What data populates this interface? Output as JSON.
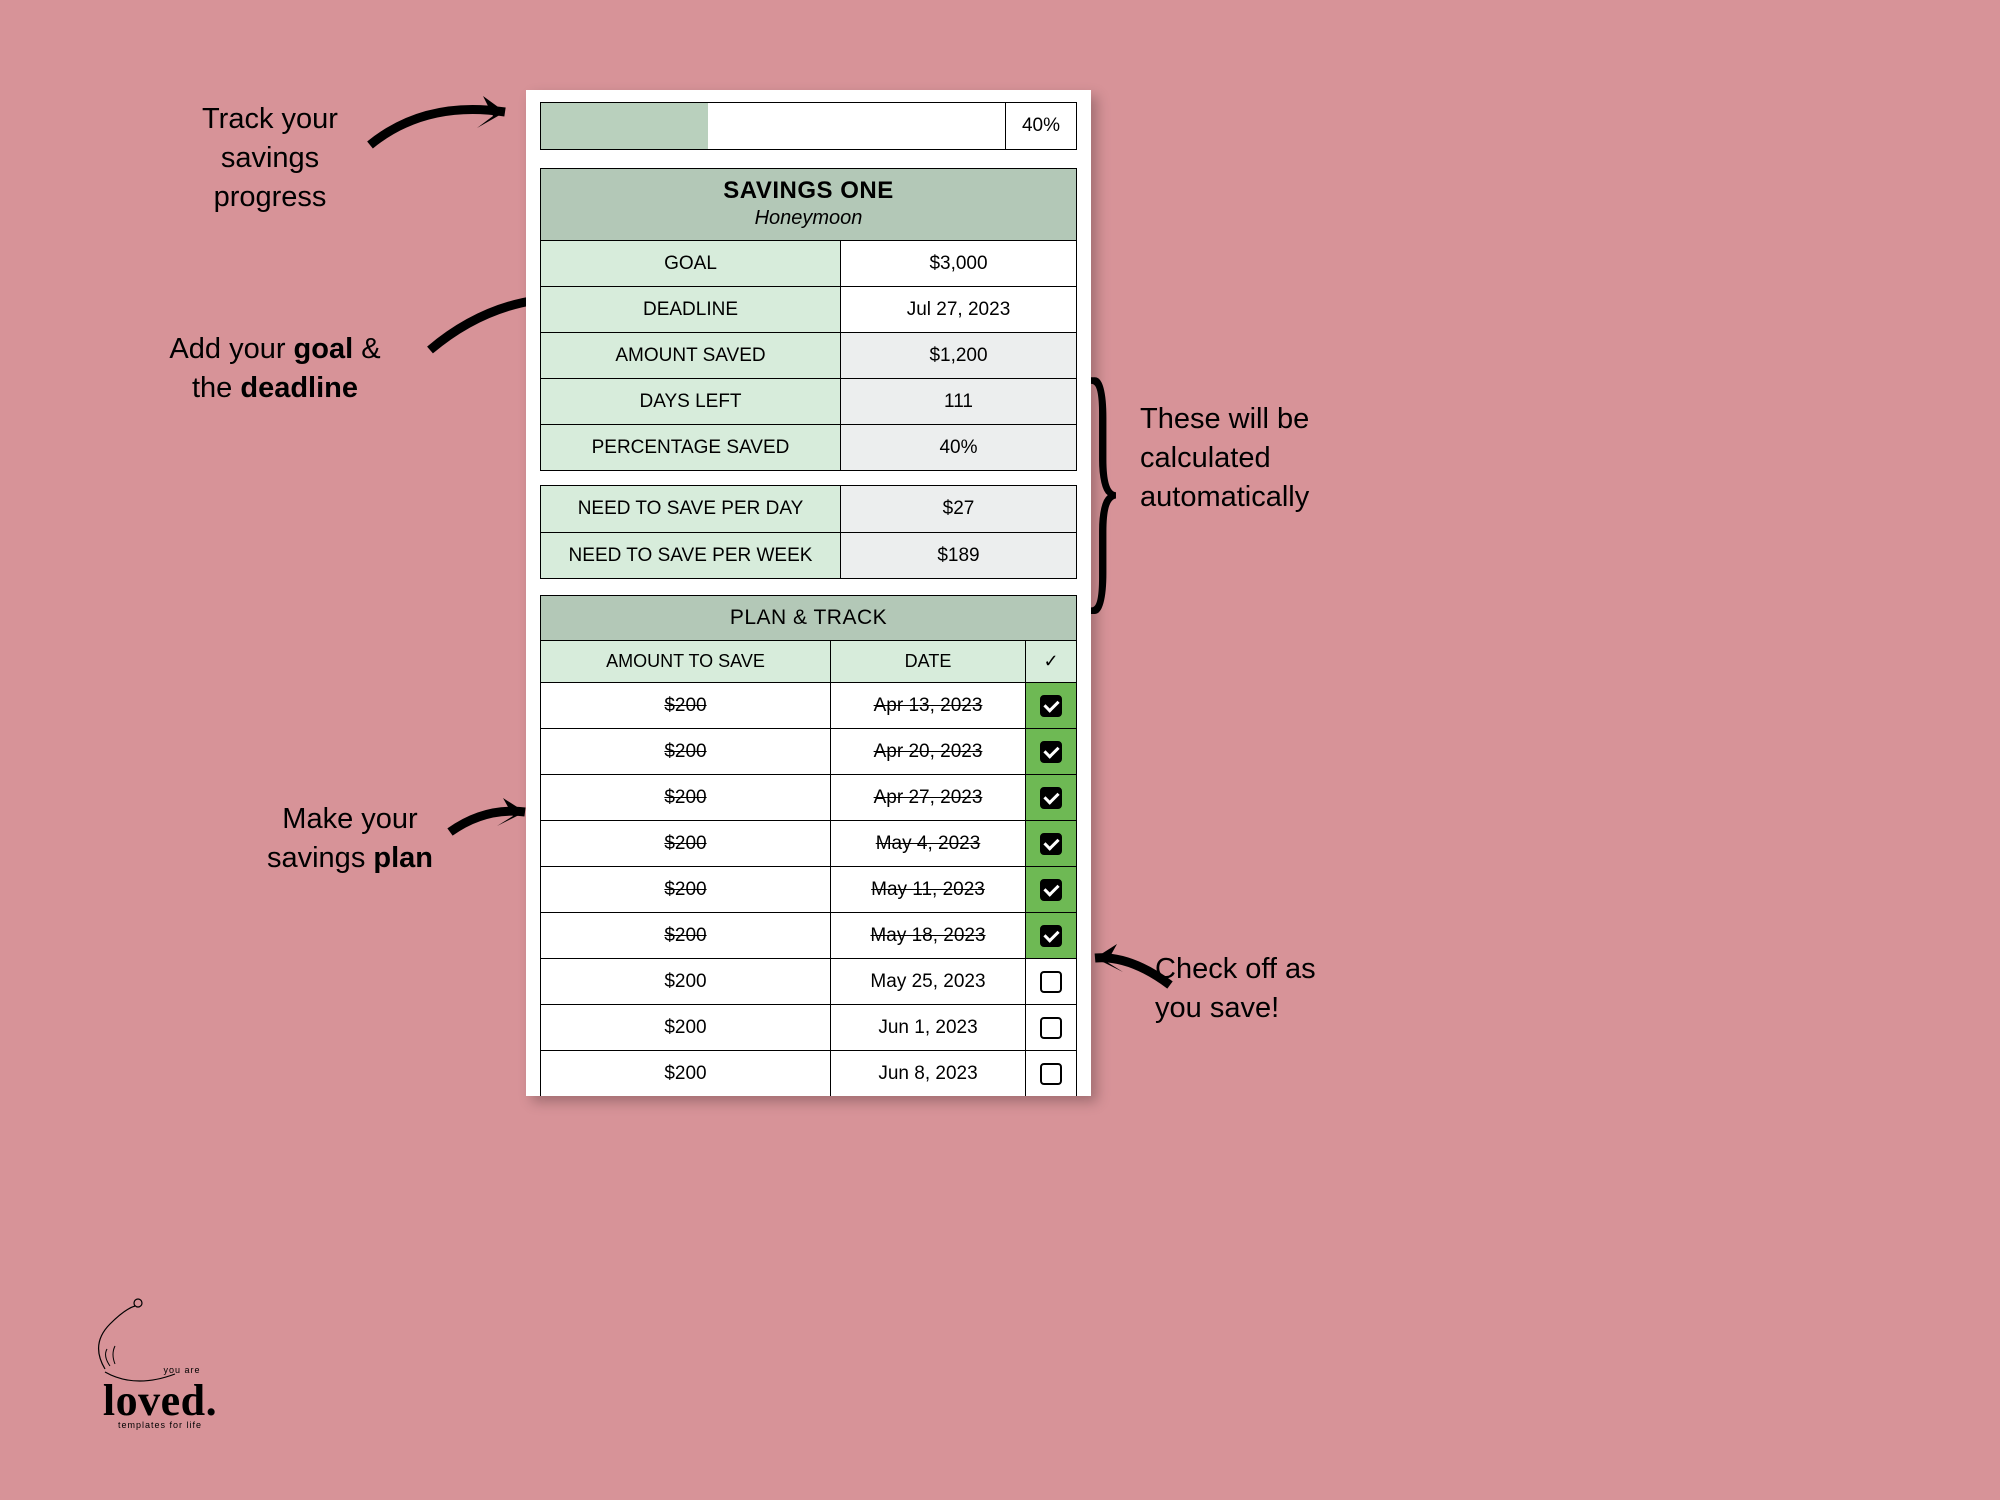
{
  "progress": {
    "percent_label": "40%",
    "fill_percent": 36
  },
  "savings": {
    "title": "SAVINGS ONE",
    "subtitle": "Honeymoon",
    "rows": [
      {
        "label": "GOAL",
        "value": "$3,000",
        "calc": false
      },
      {
        "label": "DEADLINE",
        "value": "Jul 27, 2023",
        "calc": false
      },
      {
        "label": "AMOUNT SAVED",
        "value": "$1,200",
        "calc": true
      },
      {
        "label": "DAYS LEFT",
        "value": "111",
        "calc": true
      },
      {
        "label": "PERCENTAGE SAVED",
        "value": "40%",
        "calc": true
      }
    ]
  },
  "need": {
    "rows": [
      {
        "label": "NEED TO SAVE PER DAY",
        "value": "$27"
      },
      {
        "label": "NEED TO SAVE PER WEEK",
        "value": "$189"
      }
    ]
  },
  "plan": {
    "title": "PLAN & TRACK",
    "cols": {
      "amount": "AMOUNT TO SAVE",
      "date": "DATE",
      "check": "✓"
    },
    "rows": [
      {
        "amount": "$200",
        "date": "Apr 13, 2023",
        "checked": true
      },
      {
        "amount": "$200",
        "date": "Apr 20, 2023",
        "checked": true
      },
      {
        "amount": "$200",
        "date": "Apr 27, 2023",
        "checked": true
      },
      {
        "amount": "$200",
        "date": "May 4, 2023",
        "checked": true
      },
      {
        "amount": "$200",
        "date": "May 11, 2023",
        "checked": true
      },
      {
        "amount": "$200",
        "date": "May 18, 2023",
        "checked": true
      },
      {
        "amount": "$200",
        "date": "May 25, 2023",
        "checked": false
      },
      {
        "amount": "$200",
        "date": "Jun 1, 2023",
        "checked": false
      },
      {
        "amount": "$200",
        "date": "Jun 8, 2023",
        "checked": false
      }
    ]
  },
  "callouts": {
    "progress": "Track your\nsavings\nprogress",
    "goal_pre": "Add your ",
    "goal_b1": "goal",
    "goal_mid": " &\nthe ",
    "goal_b2": "deadline",
    "auto": "These will be\ncalculated\nautomatically",
    "plan_pre": "Make your\nsavings ",
    "plan_b": "plan",
    "check": "Check off as\nyou save!"
  },
  "logo": {
    "pretitle": "you are",
    "title": "loved.",
    "subtitle": "templates for life"
  }
}
